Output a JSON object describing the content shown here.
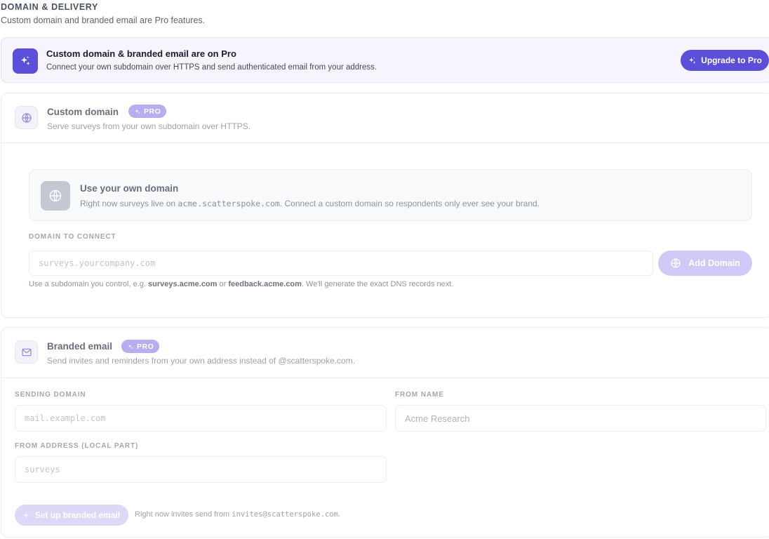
{
  "section": {
    "title": "DOMAIN & DELIVERY",
    "subtitle": "Custom domain and branded email are Pro features."
  },
  "banner": {
    "icon": "sparkles-icon",
    "title": "Custom domain & branded email are on Pro",
    "description": "Connect your own subdomain over HTTPS and send authenticated email from your address.",
    "upgrade_label": "Upgrade to Pro"
  },
  "custom_domain": {
    "icon": "globe-icon",
    "title": "Custom domain",
    "badge": "PRO",
    "description": "Serve surveys from your own subdomain over HTTPS.",
    "own_domain": {
      "title": "Use your own domain",
      "desc_prefix": "Right now surveys live on ",
      "current_domain": "acme.scatterspoke.com",
      "desc_suffix": ". Connect a custom domain so respondents only ever see your brand."
    },
    "field_label": "DOMAIN TO CONNECT",
    "input_placeholder": "surveys.yourcompany.com",
    "add_button_label": "Add Domain",
    "hint_prefix": "Use a subdomain you control, e.g. ",
    "hint_example_1": "surveys.acme.com",
    "hint_or": " or ",
    "hint_example_2": "feedback.acme.com",
    "hint_suffix": ". We'll generate the exact DNS records next."
  },
  "branded_email": {
    "icon": "mail-icon",
    "title": "Branded email",
    "badge": "PRO",
    "description": "Send invites and reminders from your own address instead of @scatterspoke.com.",
    "sending_domain_label": "SENDING DOMAIN",
    "sending_domain_placeholder": "mail.example.com",
    "from_name_label": "FROM NAME",
    "from_name_placeholder": "Acme Research",
    "from_address_label": "FROM ADDRESS (LOCAL PART)",
    "from_address_placeholder": "surveys",
    "setup_button_label": "Set up branded email",
    "note_prefix": "Right now invites send from ",
    "note_address": "invites@scatterspoke.com",
    "note_suffix": "."
  },
  "colors": {
    "accent": "#5b4fd9",
    "accent_disabled": "#cfcaf5",
    "badge": "#b6aef0"
  }
}
